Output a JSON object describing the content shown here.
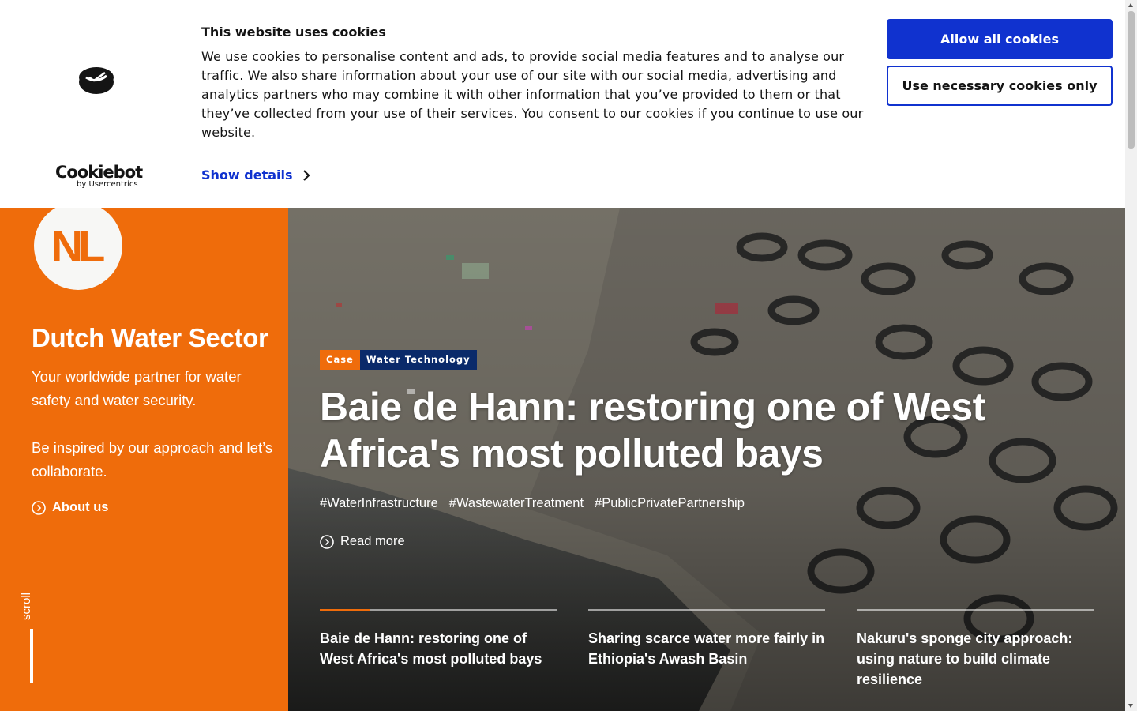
{
  "cookie_banner": {
    "title": "This website uses cookies",
    "text": "We use cookies to personalise content and ads, to provide social media features and to analyse our traffic. We also share information about your use of our site with our social media, advertising and analytics partners who may combine it with other information that you’ve provided to them or that they’ve collected from your use of their services. You consent to our cookies if you continue to use our website.",
    "show_details": "Show details",
    "allow_all": "Allow all cookies",
    "necessary_only": "Use necessary cookies only",
    "brand_main": "Cookiebot",
    "brand_sub": "by Usercentrics",
    "accent_color": "#1032cf"
  },
  "sidebar": {
    "logo_text": "NL",
    "title": "Dutch Water Sector",
    "text1": "Your worldwide partner for water safety and water security.",
    "text2": "Be inspired by our approach and let’s collaborate.",
    "about_link": "About us",
    "scroll_label": "scroll",
    "brand_color": "#ef6c0b"
  },
  "hero": {
    "tag_type": "Case",
    "tag_topic": "Water Technology",
    "title": "Baie de Hann: restoring one of West Africa's most polluted bays",
    "hashtags": [
      "#WaterInfrastructure",
      "#WastewaterTreatment",
      "#PublicPrivatePartnership"
    ],
    "read_more": "Read more",
    "slide_progress": 0.21,
    "stories": [
      {
        "title": "Baie de Hann: restoring one of West Africa's most polluted bays"
      },
      {
        "title": "Sharing scarce water more fairly in Ethiopia's Awash Basin"
      },
      {
        "title": "Nakuru's sponge city approach: using nature to build climate resilience"
      }
    ]
  },
  "icons": {
    "cookiebot_logo": "cookiebot-logo-icon",
    "chevron": "chevron-right-icon",
    "arrow": "circle-arrow-icon"
  }
}
